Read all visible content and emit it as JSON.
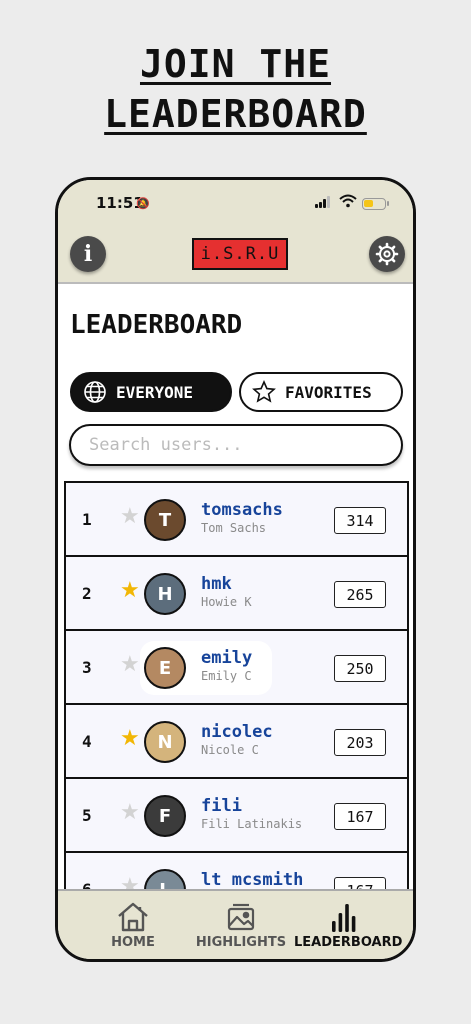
{
  "headline": {
    "line1": "JOIN THE",
    "line2": "LEADERBOARD"
  },
  "status_bar": {
    "time": "11:51"
  },
  "header": {
    "logo_text": "i.S.R.U",
    "info_label": "i"
  },
  "page": {
    "title": "LEADERBOARD"
  },
  "filters": {
    "everyone": "EVERYONE",
    "favorites": "FAVORITES",
    "selected": "EVERYONE"
  },
  "search": {
    "placeholder": "Search users..."
  },
  "leaderboard": [
    {
      "rank": "1",
      "username": "tomsachs",
      "full_name": "Tom Sachs",
      "score": "314",
      "favorite": false
    },
    {
      "rank": "2",
      "username": "hmk",
      "full_name": "Howie K",
      "score": "265",
      "favorite": true
    },
    {
      "rank": "3",
      "username": "emily",
      "full_name": "Emily C",
      "score": "250",
      "favorite": false
    },
    {
      "rank": "4",
      "username": "nicolec",
      "full_name": "Nicole C",
      "score": "203",
      "favorite": true
    },
    {
      "rank": "5",
      "username": "fili",
      "full_name": "Fili Latinakis",
      "score": "167",
      "favorite": false
    },
    {
      "rank": "6",
      "username": "lt mcsmith",
      "full_name": "",
      "score": "167",
      "favorite": false
    }
  ],
  "tabbar": {
    "home": "HOME",
    "highlights": "HIGHLIGHTS",
    "leaderboard": "LEADERBOARD",
    "active": "LEADERBOARD"
  },
  "colors": {
    "header_bg": "#e6e4d2",
    "logo_red": "#e53030",
    "username_blue": "#17449a",
    "star_gold": "#f2b705"
  }
}
